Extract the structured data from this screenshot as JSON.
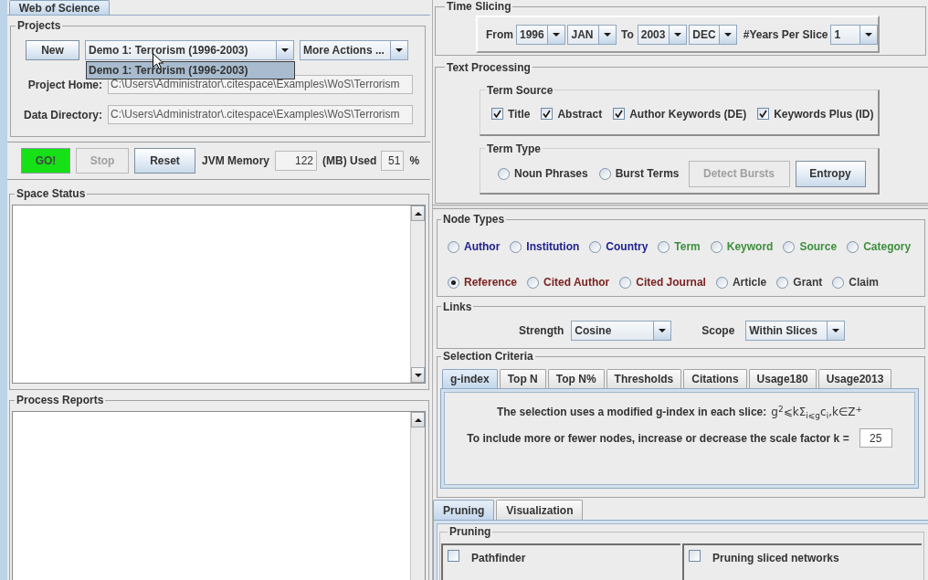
{
  "left_tabs": [
    {
      "label": "Web of Science",
      "selected": true
    }
  ],
  "projects": {
    "title": "Projects",
    "new_button": "New",
    "project": "Demo 1: Terrorism (1996-2003)",
    "more_actions": "More Actions ...",
    "project_list": [
      {
        "label": "Demo 1: Terrorism (1996-2003)",
        "selected": true
      }
    ],
    "fields": [
      {
        "label": "Project Home:",
        "value": "C:\\Users\\Administrator\\.citespace\\Examples\\WoS\\Terrorism"
      },
      {
        "label": "Data Directory:",
        "value": "C:\\Users\\Administrator\\.citespace\\Examples\\WoS\\Terrorism"
      }
    ]
  },
  "run_controls": {
    "buttons": [
      {
        "label": "GO!",
        "kind": "go",
        "disabled": false
      },
      {
        "label": "Stop",
        "kind": "plain",
        "disabled": true
      },
      {
        "label": "Reset",
        "kind": "plain",
        "disabled": false
      }
    ],
    "memory_label": "JVM Memory",
    "memory_value": "122",
    "used_label": "(MB) Used",
    "used_value": "51",
    "percent_label": "%"
  },
  "space_status": {
    "title": "Space Status"
  },
  "process_reports": {
    "title": "Process Reports"
  },
  "time_slicing": {
    "title": "Time Slicing",
    "from_label": "From",
    "from_year": "1996",
    "from_month": "JAN",
    "to_label": "To",
    "to_year": "2003",
    "to_month": "DEC",
    "years_per_slice_label": "#Years Per Slice",
    "years_per_slice": "1"
  },
  "text_processing": {
    "title": "Text Processing",
    "term_source": {
      "title": "Term Source",
      "options": [
        {
          "label": "Title",
          "checked": true
        },
        {
          "label": "Abstract",
          "checked": true
        },
        {
          "label": "Author Keywords (DE)",
          "checked": true
        },
        {
          "label": "Keywords Plus (ID)",
          "checked": true
        }
      ]
    },
    "term_type": {
      "title": "Term Type",
      "options": [
        {
          "label": "Noun Phrases",
          "selected": false
        },
        {
          "label": "Burst Terms",
          "selected": false
        }
      ],
      "buttons": [
        {
          "label": "Detect Bursts",
          "disabled": true
        },
        {
          "label": "Entropy",
          "disabled": false
        }
      ]
    }
  },
  "node_types": {
    "title": "Node Types",
    "rows": [
      {
        "items": [
          {
            "label": "Author",
            "selected": false,
            "color": "#20208f"
          },
          {
            "label": "Institution",
            "selected": false,
            "color": "#20208f"
          },
          {
            "label": "Country",
            "selected": false,
            "color": "#20208f"
          },
          {
            "label": "Term",
            "selected": false,
            "color": "#3d8f3d"
          },
          {
            "label": "Keyword",
            "selected": false,
            "color": "#3d8f3d"
          },
          {
            "label": "Source",
            "selected": false,
            "color": "#3d8f3d"
          },
          {
            "label": "Category",
            "selected": false,
            "color": "#3d8f3d"
          }
        ]
      },
      {
        "items": [
          {
            "label": "Reference",
            "selected": true,
            "color": "#7a1f1f"
          },
          {
            "label": "Cited Author",
            "selected": false,
            "color": "#7a1f1f"
          },
          {
            "label": "Cited Journal",
            "selected": false,
            "color": "#7a1f1f"
          },
          {
            "label": "Article",
            "selected": false,
            "color": "#3c3c3c"
          },
          {
            "label": "Grant",
            "selected": false,
            "color": "#3c3c3c"
          },
          {
            "label": "Claim",
            "selected": false,
            "color": "#3c3c3c"
          }
        ]
      }
    ]
  },
  "links": {
    "title": "Links",
    "strength_label": "Strength",
    "strength": "Cosine",
    "scope_label": "Scope",
    "scope": "Within Slices"
  },
  "selection_criteria": {
    "title": "Selection Criteria",
    "tabs": [
      {
        "label": "g-index",
        "selected": true
      },
      {
        "label": "Top N",
        "selected": false
      },
      {
        "label": "Top N%",
        "selected": false
      },
      {
        "label": "Thresholds",
        "selected": false
      },
      {
        "label": "Citations",
        "selected": false
      },
      {
        "label": "Usage180",
        "selected": false
      },
      {
        "label": "Usage2013",
        "selected": false
      }
    ],
    "description": "The selection uses a modified g-index in each slice:",
    "formula": "g$^{2}$⩽kΣ$_{i⩽g}$c$_{i}$,k∈Z$^{+}$",
    "scale_label": "To include more or fewer nodes, increase or decrease the scale factor k =",
    "scale_value": "25"
  },
  "bottom_tabs": [
    {
      "label": "Pruning",
      "selected": true
    },
    {
      "label": "Visualization",
      "selected": false
    }
  ],
  "pruning": {
    "title": "Pruning",
    "options": [
      {
        "label": "Pathfinder",
        "checked": false
      },
      {
        "label": "Pruning sliced networks",
        "checked": false
      }
    ]
  }
}
